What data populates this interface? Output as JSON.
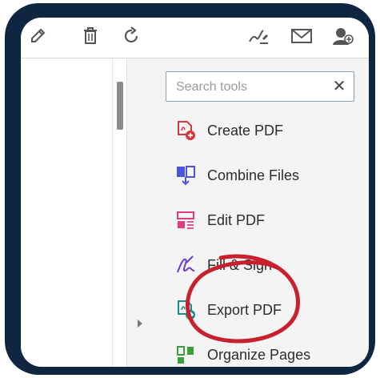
{
  "toolbar": {
    "icons": [
      "edit-icon",
      "trash-icon",
      "rotate-icon",
      "sign-icon",
      "mail-icon",
      "add-user-icon"
    ]
  },
  "tools_panel": {
    "search": {
      "placeholder": "Search tools",
      "value": "",
      "clear_label": "✕"
    },
    "items": [
      {
        "label": "Create PDF",
        "icon": "create-pdf-icon",
        "color": "#d7373f"
      },
      {
        "label": "Combine Files",
        "icon": "combine-files-icon",
        "color": "#4b53e0"
      },
      {
        "label": "Edit PDF",
        "icon": "edit-pdf-icon",
        "color": "#e33a82"
      },
      {
        "label": "Fill & Sign",
        "icon": "fill-sign-icon",
        "color": "#6c3fc7"
      },
      {
        "label": "Export PDF",
        "icon": "export-pdf-icon",
        "color": "#1a8a8a"
      },
      {
        "label": "Organize Pages",
        "icon": "organize-pages-icon",
        "color": "#3a9e3a"
      }
    ]
  },
  "colors": {
    "frame": "#0f2640",
    "annotation_circle": "#c8202e",
    "panel_bg": "#f4f4f4"
  }
}
